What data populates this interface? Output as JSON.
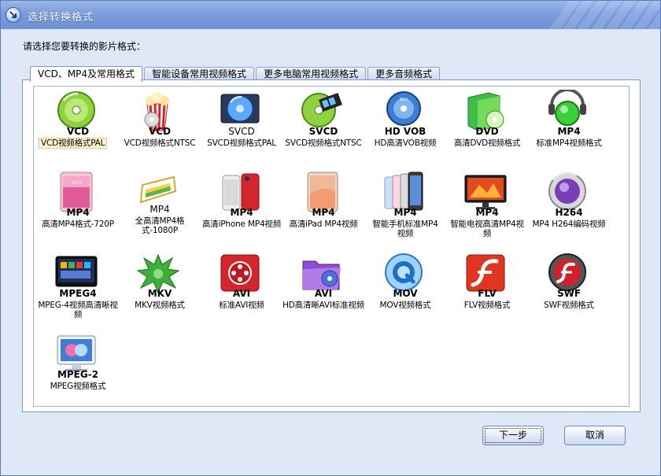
{
  "window": {
    "title": "选择转换格式",
    "prompt": "请选择您要转换的影片格式：",
    "colors": {
      "titlebar": "#7a9cdc",
      "background": "#dfe8f7",
      "panel_border": "#7f98c4"
    }
  },
  "tabs": [
    {
      "label": "VCD、MP4及常用格式",
      "active": true
    },
    {
      "label": "智能设备常用视频格式",
      "active": false
    },
    {
      "label": "更多电脑常用视频格式",
      "active": false
    },
    {
      "label": "更多音频格式",
      "active": false
    }
  ],
  "formats": [
    {
      "name": "VCD",
      "desc": "VCD视频格式PAL",
      "icon": "vcd-disc-icon",
      "selected": true
    },
    {
      "name": "VCD",
      "desc": "VCD视频格式NTSC",
      "icon": "popcorn-disc-icon"
    },
    {
      "name": "SVCD",
      "desc": "SVCD视频格式PAL",
      "icon": "svcd-disc-icon"
    },
    {
      "name": "SVCD",
      "desc": "SVCD视频格式NTSC",
      "icon": "svcd-film-disc-icon"
    },
    {
      "name": "HD VOB",
      "desc": "HD高清VOB视频",
      "icon": "bluray-disc-icon"
    },
    {
      "name": "DVD",
      "desc": "高清DVD视频格式",
      "icon": "dvd-folder-icon"
    },
    {
      "name": "MP4",
      "desc": "标准MP4视频格式",
      "icon": "mp4-player-icon"
    },
    {
      "name": "MP4",
      "desc": "高清MP4格式-720P",
      "icon": "tablet-icon"
    },
    {
      "name": "MP4",
      "desc": "全高清MP4格式-1080P",
      "icon": "easel-icon"
    },
    {
      "name": "MP4",
      "desc": "高清iPhone MP4视频",
      "icon": "iphone-icon"
    },
    {
      "name": "MP4",
      "desc": "高清iPad MP4视频",
      "icon": "ipad-icon"
    },
    {
      "name": "MP4",
      "desc": "智能手机标准MP4视频",
      "icon": "smartphones-icon"
    },
    {
      "name": "MP4",
      "desc": "智能电视高清MP4视频",
      "icon": "tv-icon"
    },
    {
      "name": "H264",
      "desc": "MP4 H264编码视频",
      "icon": "h264-orb-icon"
    },
    {
      "name": "MPEG4",
      "desc": "MPEG-4视频高清晰视频",
      "icon": "mpeg4-screen-icon"
    },
    {
      "name": "MKV",
      "desc": "MKV视频格式",
      "icon": "mkv-splash-icon"
    },
    {
      "name": "AVI",
      "desc": "标准AVI视频",
      "icon": "avi-reel-icon"
    },
    {
      "name": "AVI",
      "desc": "HD高清晰AVI标准视频",
      "icon": "avi-folder-icon"
    },
    {
      "name": "MOV",
      "desc": "MOV视频格式",
      "icon": "quicktime-icon"
    },
    {
      "name": "FLV",
      "desc": "FLV视频格式",
      "icon": "flash-icon"
    },
    {
      "name": "SWF",
      "desc": "SWF视频格式",
      "icon": "swf-orb-icon"
    },
    {
      "name": "MPEG-2",
      "desc": "MPEG视频格式",
      "icon": "mpeg2-monitor-icon"
    }
  ],
  "buttons": {
    "next": "下一步",
    "cancel": "取消"
  }
}
